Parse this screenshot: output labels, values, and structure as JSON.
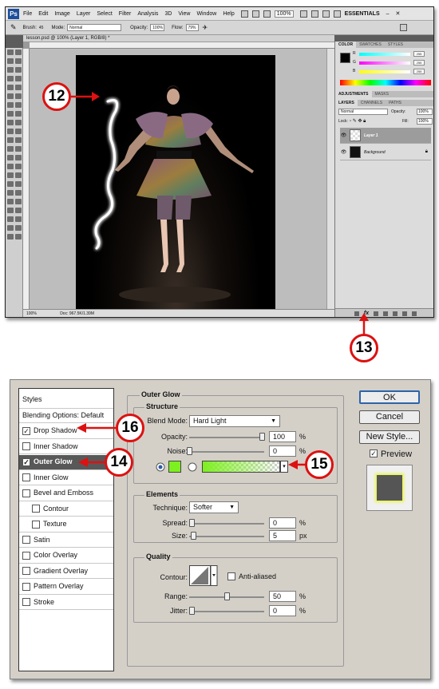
{
  "menubar": {
    "items": [
      "File",
      "Edit",
      "Image",
      "Layer",
      "Select",
      "Filter",
      "Analysis",
      "3D",
      "View",
      "Window",
      "Help"
    ],
    "zoom": "100%",
    "workspace": "ESSENTIALS"
  },
  "options": {
    "brush_label": "Brush:",
    "brush_size": "45",
    "mode_label": "Mode:",
    "mode_value": "Normal",
    "opacity_label": "Opacity:",
    "opacity_value": "100%",
    "flow_label": "Flow:",
    "flow_value": "79%"
  },
  "document": {
    "tab_title": "lesson.psd @ 100% (Layer 1, RGB/8) *",
    "zoom": "100%",
    "status": "Doc: 967.5K/1.39M"
  },
  "color_panel": {
    "tabs": [
      "COLOR",
      "SWATCHES",
      "STYLES"
    ],
    "channels": [
      {
        "label": "R",
        "value": "255"
      },
      {
        "label": "G",
        "value": "255"
      },
      {
        "label": "B",
        "value": "255"
      }
    ]
  },
  "adjust_tabs": [
    "ADJUSTMENTS",
    "MASKS"
  ],
  "layers_panel": {
    "tabs": [
      "LAYERS",
      "CHANNELS",
      "PATHS"
    ],
    "blend_mode": "Normal",
    "opacity_label": "Opacity:",
    "opacity": "100%",
    "lock_label": "Lock:",
    "fill_label": "Fill:",
    "fill": "100%",
    "layers": [
      {
        "name": "Layer 1",
        "selected": true
      },
      {
        "name": "Background",
        "selected": false
      }
    ]
  },
  "callouts": {
    "c12": "12",
    "c13": "13",
    "c14": "14",
    "c15": "15",
    "c16": "16"
  },
  "dialog": {
    "styles_header": "Styles",
    "styles": [
      {
        "label": "Blending Options: Default",
        "checkbox": false,
        "checked": false,
        "indent": false,
        "active": false
      },
      {
        "label": "Drop Shadow",
        "checkbox": true,
        "checked": true,
        "indent": false,
        "active": false
      },
      {
        "label": "Inner Shadow",
        "checkbox": true,
        "checked": false,
        "indent": false,
        "active": false
      },
      {
        "label": "Outer Glow",
        "checkbox": true,
        "checked": true,
        "indent": false,
        "active": true
      },
      {
        "label": "Inner Glow",
        "checkbox": true,
        "checked": false,
        "indent": false,
        "active": false
      },
      {
        "label": "Bevel and Emboss",
        "checkbox": true,
        "checked": false,
        "indent": false,
        "active": false
      },
      {
        "label": "Contour",
        "checkbox": true,
        "checked": false,
        "indent": true,
        "active": false
      },
      {
        "label": "Texture",
        "checkbox": true,
        "checked": false,
        "indent": true,
        "active": false
      },
      {
        "label": "Satin",
        "checkbox": true,
        "checked": false,
        "indent": false,
        "active": false
      },
      {
        "label": "Color Overlay",
        "checkbox": true,
        "checked": false,
        "indent": false,
        "active": false
      },
      {
        "label": "Gradient Overlay",
        "checkbox": true,
        "checked": false,
        "indent": false,
        "active": false
      },
      {
        "label": "Pattern Overlay",
        "checkbox": true,
        "checked": false,
        "indent": false,
        "active": false
      },
      {
        "label": "Stroke",
        "checkbox": true,
        "checked": false,
        "indent": false,
        "active": false
      }
    ],
    "title": "Outer Glow",
    "structure": {
      "heading": "Structure",
      "blend_mode_label": "Blend Mode:",
      "blend_mode": "Hard Light",
      "opacity_label": "Opacity:",
      "opacity": "100",
      "opacity_level": 0.97,
      "noise_label": "Noise:",
      "noise": "0",
      "noise_level": 0,
      "unit": "%",
      "glow_color": "#7df01f"
    },
    "elements": {
      "heading": "Elements",
      "technique_label": "Technique:",
      "technique": "Softer",
      "spread_label": "Spread:",
      "spread": "0",
      "spread_unit": "%",
      "size_label": "Size:",
      "size": "5",
      "size_unit": "px"
    },
    "quality": {
      "heading": "Quality",
      "contour_label": "Contour:",
      "anti_aliased_label": "Anti-aliased",
      "range_label": "Range:",
      "range": "50",
      "range_unit": "%",
      "range_level": 0.5,
      "jitter_label": "Jitter:",
      "jitter": "0",
      "jitter_unit": "%"
    },
    "buttons": {
      "ok": "OK",
      "cancel": "Cancel",
      "new_style": "New Style...",
      "preview": "Preview"
    },
    "preview_checked": true
  },
  "colors": {
    "accent_red": "#dd1111",
    "glow_green": "#7df01f",
    "active_row": "#585858"
  }
}
